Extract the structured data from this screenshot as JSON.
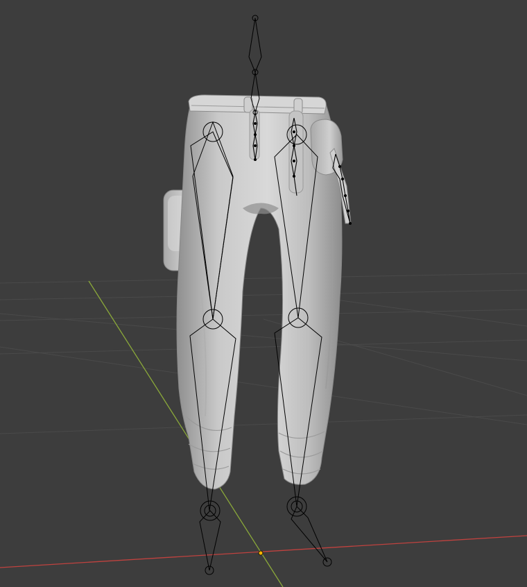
{
  "viewport": {
    "background": "#3d3d3d",
    "grid_color": "#4a4a4a",
    "x_axis_color": "#c0423f",
    "y_axis_color": "#8aa83a",
    "origin_color": "#ffb400"
  },
  "scene": {
    "mesh": {
      "type": "pants",
      "shading": "solid",
      "color": "#c8c8c8"
    },
    "armature": {
      "display": "octahedral",
      "bone_color": "#000000"
    }
  }
}
